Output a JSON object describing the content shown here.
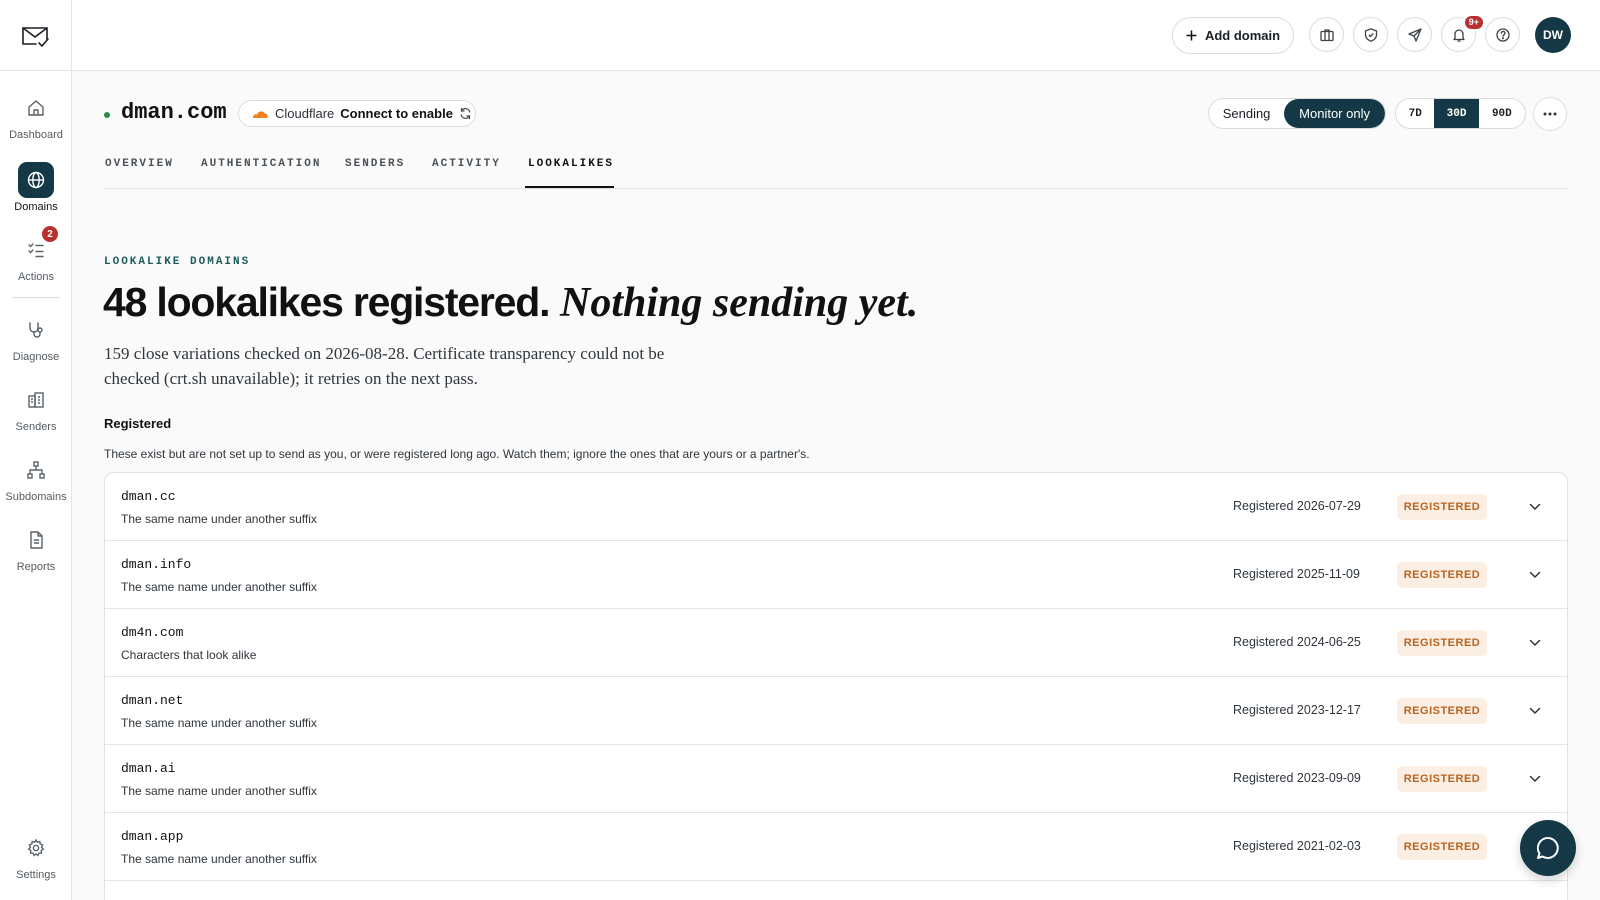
{
  "sidebar": {
    "logo_icon": "mail-check-icon",
    "items": [
      {
        "label": "Dashboard",
        "icon": "home-icon"
      },
      {
        "label": "Domains",
        "icon": "globe-icon",
        "active": true
      },
      {
        "label": "Actions",
        "icon": "checklist-icon",
        "badge": "2"
      },
      {
        "label": "Diagnose",
        "icon": "stethoscope-icon"
      },
      {
        "label": "Senders",
        "icon": "building-icon"
      },
      {
        "label": "Subdomains",
        "icon": "hierarchy-icon"
      },
      {
        "label": "Reports",
        "icon": "document-icon"
      },
      {
        "label": "Settings",
        "icon": "gear-icon"
      }
    ]
  },
  "topbar": {
    "add_domain_label": "Add domain",
    "notifications_badge": "9+",
    "avatar_initials": "DW"
  },
  "domain": {
    "name": "dman.com",
    "cloudflare_label": "Cloudflare",
    "cloudflare_action": "Connect to enable",
    "mode_options": [
      "Sending",
      "Monitor only"
    ],
    "mode_selected": "Monitor only",
    "range_options": [
      "7D",
      "30D",
      "90D"
    ],
    "range_selected": "30D"
  },
  "tabs": [
    "OVERVIEW",
    "AUTHENTICATION",
    "SENDERS",
    "ACTIVITY",
    "LOOKALIKES"
  ],
  "active_tab": "LOOKALIKES",
  "content": {
    "eyebrow": "LOOKALIKE DOMAINS",
    "headline_strong": "48 lookalikes registered.",
    "headline_italic": "Nothing sending yet.",
    "lede": "159 close variations checked on 2026-08-28. Certificate transparency could not be checked (crt.sh unavailable); it retries on the next pass.",
    "section_title": "Registered",
    "section_desc": "These exist but are not set up to send as you, or were registered long ago. Watch them; ignore the ones that are yours or a partner's.",
    "rows": [
      {
        "domain": "dman.cc",
        "kind": "The same name under another suffix",
        "date": "Registered 2026-07-29",
        "status": "REGISTERED"
      },
      {
        "domain": "dman.info",
        "kind": "The same name under another suffix",
        "date": "Registered 2025-11-09",
        "status": "REGISTERED"
      },
      {
        "domain": "dm4n.com",
        "kind": "Characters that look alike",
        "date": "Registered 2024-06-25",
        "status": "REGISTERED"
      },
      {
        "domain": "dman.net",
        "kind": "The same name under another suffix",
        "date": "Registered 2023-12-17",
        "status": "REGISTERED"
      },
      {
        "domain": "dman.ai",
        "kind": "The same name under another suffix",
        "date": "Registered 2023-09-09",
        "status": "REGISTERED"
      },
      {
        "domain": "dman.app",
        "kind": "The same name under another suffix",
        "date": "Registered 2021-02-03",
        "status": "REGISTERED"
      }
    ]
  },
  "colors": {
    "brand_dark": "#143845",
    "status_green": "#2a8a49",
    "badge_red": "#b8312f",
    "registered_bg": "#fbeee3",
    "registered_text": "#b8641f",
    "cloudflare_orange": "#f48120"
  }
}
